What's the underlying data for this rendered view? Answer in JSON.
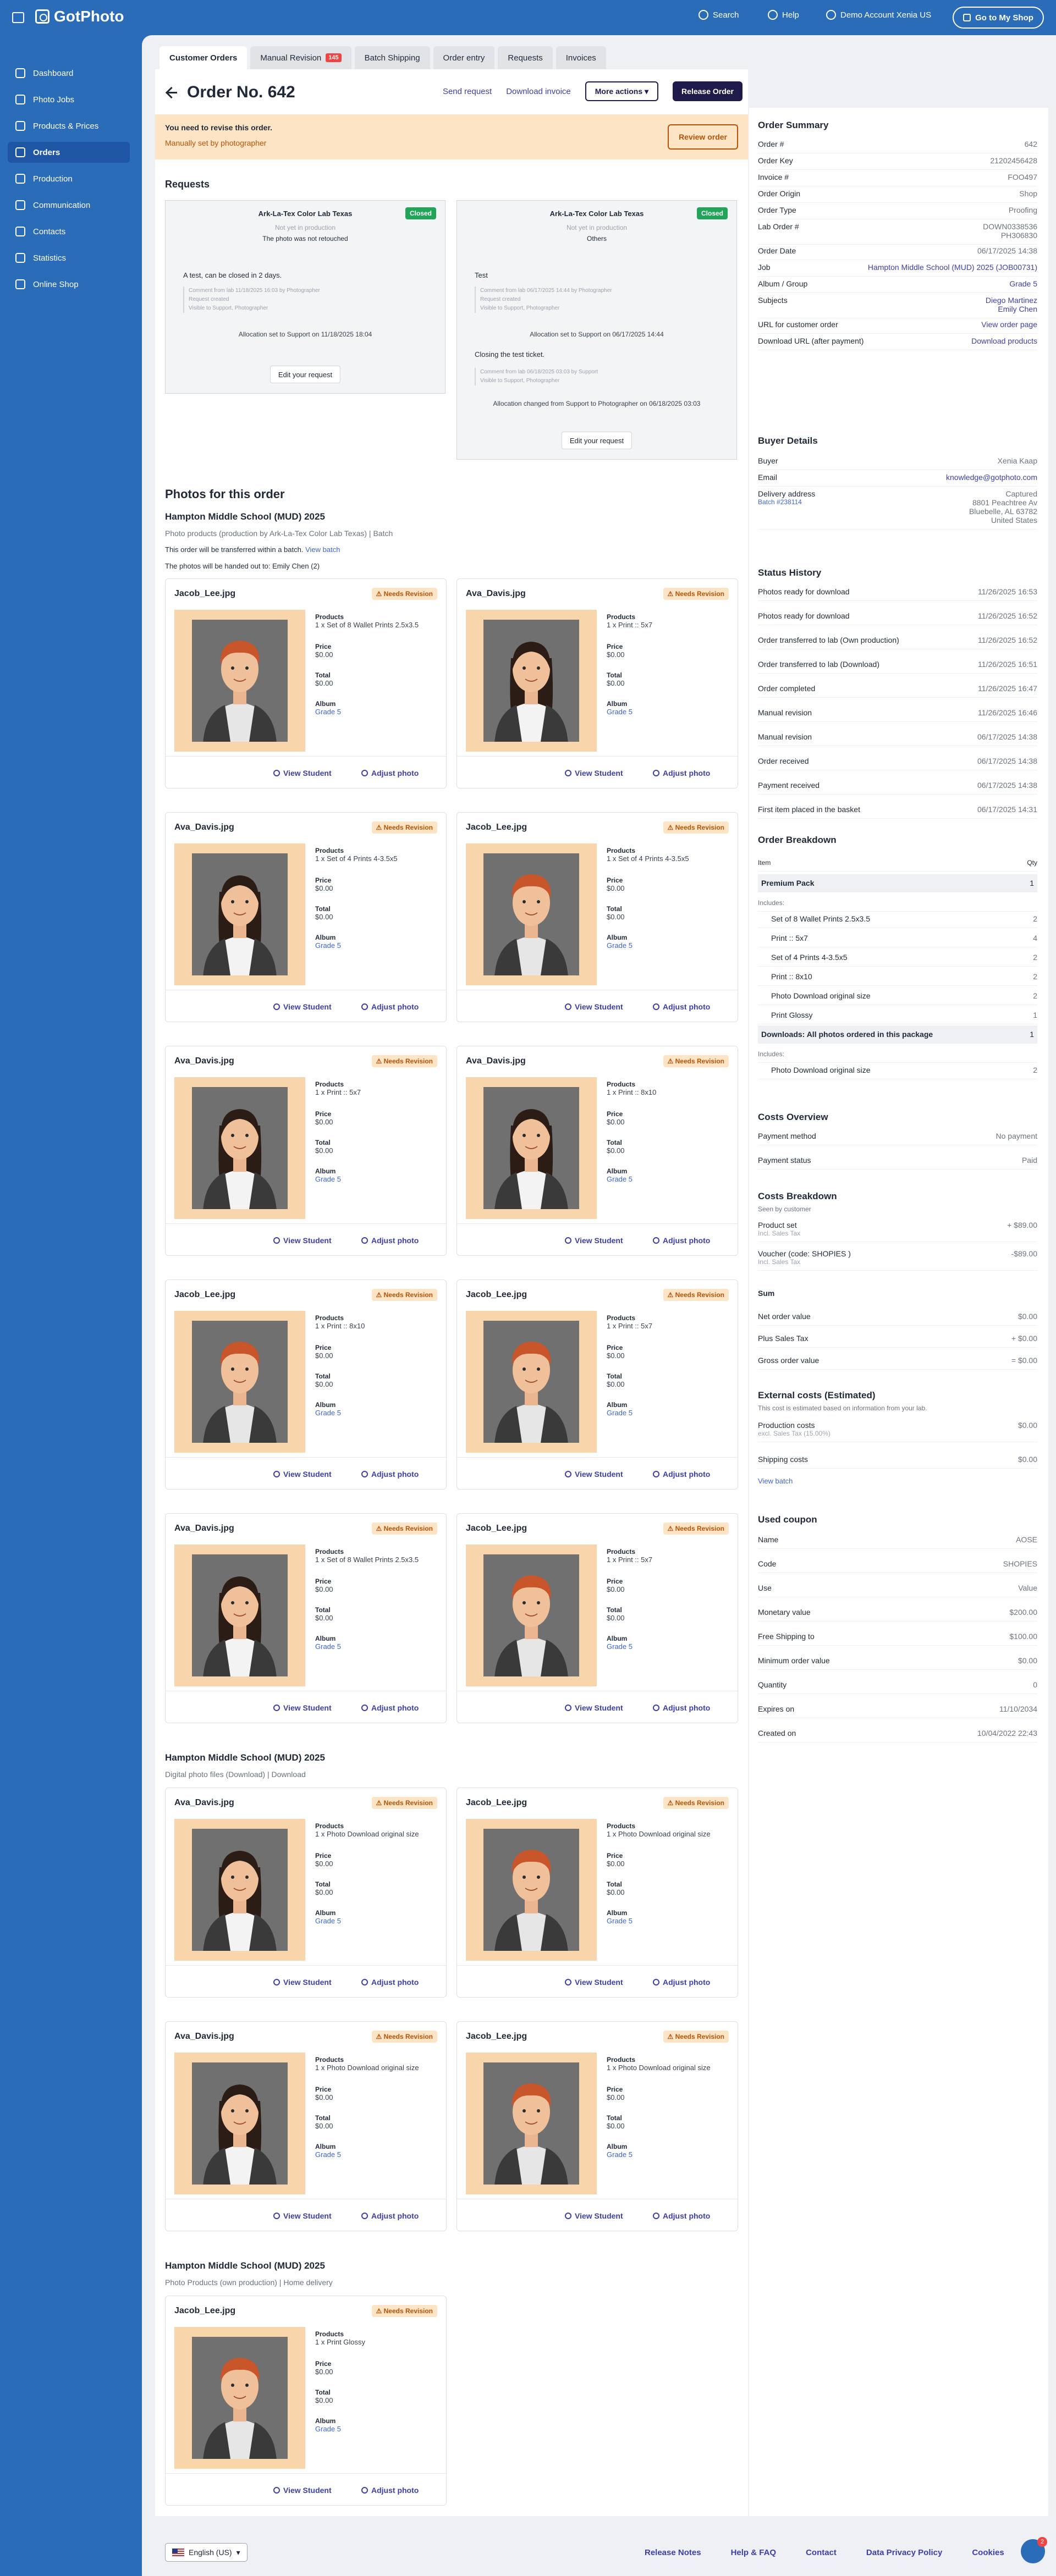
{
  "brand": {
    "name": "GotPhoto"
  },
  "topnav": {
    "search": "Search",
    "help": "Help",
    "account": "Demo Account Xenia US",
    "shop": "Go to My Shop"
  },
  "sidebar": {
    "items": [
      {
        "label": "Dashboard",
        "icon": "dashboard-icon"
      },
      {
        "label": "Photo Jobs",
        "icon": "camera-icon"
      },
      {
        "label": "Products & Prices",
        "icon": "tag-icon"
      },
      {
        "label": "Orders",
        "icon": "cart-icon"
      },
      {
        "label": "Production",
        "icon": "box-icon"
      },
      {
        "label": "Communication",
        "icon": "mail-icon"
      },
      {
        "label": "Contacts",
        "icon": "contacts-icon"
      },
      {
        "label": "Statistics",
        "icon": "chart-icon"
      },
      {
        "label": "Online Shop",
        "icon": "store-icon"
      }
    ]
  },
  "tabs": [
    {
      "label": "Customer Orders"
    },
    {
      "label": "Manual Revision",
      "badge": "145"
    },
    {
      "label": "Batch Shipping"
    },
    {
      "label": "Order entry"
    },
    {
      "label": "Requests"
    },
    {
      "label": "Invoices"
    }
  ],
  "order": {
    "title": "Order No. 642",
    "send_request": "Send request",
    "download_invoice": "Download invoice",
    "more_actions": "More actions",
    "release": "Release Order"
  },
  "alert": {
    "title": "You need to revise this order.",
    "sub": "Manually set by photographer",
    "button": "Review order"
  },
  "requests": {
    "title": "Requests",
    "items": [
      {
        "lab": "Ark-La-Tex Color Lab Texas",
        "status": "Closed",
        "line1": "Not yet in production",
        "line2": "The photo was not retouched",
        "msg": "A test, can be closed in 2 days.",
        "thread": [
          "Comment from lab 11/18/2025 16:03 by Photographer",
          "Request created",
          "Visible to Support, Photographer"
        ],
        "alloc": "Allocation set to Support on 11/18/2025 18:04",
        "edit": "Edit your request"
      },
      {
        "lab": "Ark-La-Tex Color Lab Texas",
        "status": "Closed",
        "line1": "Not yet in production",
        "line2": "Others",
        "msg": "Test",
        "thread": [
          "Comment from lab 06/17/2025 14:44 by Photographer",
          "Request created",
          "Visible to Support, Photographer"
        ],
        "alloc": "Allocation set to Support on 06/17/2025 14:44",
        "msg2": "Closing the test ticket.",
        "thread2": [
          "Comment from lab 06/18/2025 03:03 by Support",
          "Visible to Support, Photographer"
        ],
        "alloc2": "Allocation changed from Support to Photographer on 06/18/2025 03:03",
        "edit": "Edit your request"
      }
    ]
  },
  "photos": {
    "title": "Photos for this order",
    "labels": {
      "products": "Products",
      "price": "Price",
      "total": "Total",
      "album": "Album",
      "status": "Needs Revision",
      "view": "View Student",
      "adjust": "Adjust photo"
    },
    "groups": [
      {
        "title": "Hampton Middle School (MUD) 2025",
        "sub": "Photo products (production by Ark-La-Tex Color Lab Texas)",
        "sub2": "Batch",
        "note1": "This order will be transferred within a batch.",
        "note1_link": "View batch",
        "note2": "The photos will be handed out to: Emily Chen (2)",
        "cards": [
          {
            "file": "Jacob_Lee.jpg",
            "product": "1 x Set of 8 Wallet Prints 2.5x3.5",
            "price": "$0.00",
            "total": "$0.00",
            "album": "Grade 5",
            "who": "boy"
          },
          {
            "file": "Ava_Davis.jpg",
            "product": "1 x Print :: 5x7",
            "price": "$0.00",
            "total": "$0.00",
            "album": "Grade 5",
            "who": "girl"
          },
          {
            "file": "Ava_Davis.jpg",
            "product": "1 x Set of 4 Prints 4-3.5x5",
            "price": "$0.00",
            "total": "$0.00",
            "album": "Grade 5",
            "who": "girl"
          },
          {
            "file": "Jacob_Lee.jpg",
            "product": "1 x Set of 4 Prints 4-3.5x5",
            "price": "$0.00",
            "total": "$0.00",
            "album": "Grade 5",
            "who": "boy"
          },
          {
            "file": "Ava_Davis.jpg",
            "product": "1 x Print :: 5x7",
            "price": "$0.00",
            "total": "$0.00",
            "album": "Grade 5",
            "who": "girl"
          },
          {
            "file": "Ava_Davis.jpg",
            "product": "1 x Print :: 8x10",
            "price": "$0.00",
            "total": "$0.00",
            "album": "Grade 5",
            "who": "girl"
          },
          {
            "file": "Jacob_Lee.jpg",
            "product": "1 x Print :: 8x10",
            "price": "$0.00",
            "total": "$0.00",
            "album": "Grade 5",
            "who": "boy"
          },
          {
            "file": "Jacob_Lee.jpg",
            "product": "1 x Print :: 5x7",
            "price": "$0.00",
            "total": "$0.00",
            "album": "Grade 5",
            "who": "boy"
          },
          {
            "file": "Ava_Davis.jpg",
            "product": "1 x Set of 8 Wallet Prints 2.5x3.5",
            "price": "$0.00",
            "total": "$0.00",
            "album": "Grade 5",
            "who": "girl"
          },
          {
            "file": "Jacob_Lee.jpg",
            "product": "1 x Print :: 5x7",
            "price": "$0.00",
            "total": "$0.00",
            "album": "Grade 5",
            "who": "boy"
          }
        ]
      },
      {
        "title": "Hampton Middle School (MUD) 2025",
        "sub": "Digital photo files (Download)",
        "sub2": "Download",
        "cards": [
          {
            "file": "Ava_Davis.jpg",
            "product": "1 x Photo Download original size",
            "price": "$0.00",
            "total": "$0.00",
            "album": "Grade 5",
            "who": "girl"
          },
          {
            "file": "Jacob_Lee.jpg",
            "product": "1 x Photo Download original size",
            "price": "$0.00",
            "total": "$0.00",
            "album": "Grade 5",
            "who": "boy"
          },
          {
            "file": "Ava_Davis.jpg",
            "product": "1 x Photo Download original size",
            "price": "$0.00",
            "total": "$0.00",
            "album": "Grade 5",
            "who": "girl"
          },
          {
            "file": "Jacob_Lee.jpg",
            "product": "1 x Photo Download original size",
            "price": "$0.00",
            "total": "$0.00",
            "album": "Grade 5",
            "who": "boy"
          }
        ]
      },
      {
        "title": "Hampton Middle School (MUD) 2025",
        "sub": "Photo Products (own production)",
        "sub2": "Home delivery",
        "cards": [
          {
            "file": "Jacob_Lee.jpg",
            "product": "1 x Print Glossy",
            "price": "$0.00",
            "total": "$0.00",
            "album": "Grade 5",
            "who": "boy"
          }
        ]
      }
    ]
  },
  "summary": {
    "title": "Order Summary",
    "rows": [
      {
        "k": "Order #",
        "v": "642"
      },
      {
        "k": "Order Key",
        "v": "21202456428"
      },
      {
        "k": "Invoice #",
        "v": "FOO497"
      },
      {
        "k": "Order Origin",
        "v": "Shop"
      },
      {
        "k": "Order Type",
        "v": "Proofing"
      },
      {
        "k": "Lab Order #",
        "v": "DOWN0338536\nPH306830"
      },
      {
        "k": "Order Date",
        "v": "06/17/2025 14:38"
      },
      {
        "k": "Job",
        "v": "Hampton Middle School (MUD) 2025 (JOB00731)",
        "link": true
      },
      {
        "k": "Album / Group",
        "v": "Grade 5",
        "link": true
      },
      {
        "k": "Subjects",
        "v": "Diego Martinez\nEmily Chen",
        "link": true
      },
      {
        "k": "URL for customer order",
        "v": "View order page",
        "link": true
      },
      {
        "k": "Download URL (after payment)",
        "v": "Download products",
        "link": true
      }
    ],
    "buyer_title": "Buyer Details",
    "buyer": [
      {
        "k": "Buyer",
        "v": "Xenia Kaap"
      },
      {
        "k": "Email",
        "v": "knowledge@gotphoto.com",
        "link": true
      },
      {
        "k": "Delivery address",
        "v": "Captured\n8801 Peachtree Av\nBluebelle, AL 63782\nUnited States",
        "sub": "Batch #238114"
      }
    ],
    "status_title": "Status History",
    "status": [
      {
        "k": "Photos ready for download",
        "v": "11/26/2025 16:53"
      },
      {
        "k": "Photos ready for download",
        "v": "11/26/2025 16:52"
      },
      {
        "k": "Order transferred to lab (Own production)",
        "v": "11/26/2025 16:52"
      },
      {
        "k": "Order transferred to lab (Download)",
        "v": "11/26/2025 16:51"
      },
      {
        "k": "Order completed",
        "v": "11/26/2025 16:47"
      },
      {
        "k": "Manual revision",
        "v": "11/26/2025 16:46"
      },
      {
        "k": "Manual revision",
        "v": "06/17/2025 14:38"
      },
      {
        "k": "Order received",
        "v": "06/17/2025 14:38"
      },
      {
        "k": "Payment received",
        "v": "06/17/2025 14:38"
      },
      {
        "k": "First item placed in the basket",
        "v": "06/17/2025 14:31"
      }
    ],
    "breakdown_title": "Order Breakdown",
    "breakdown_head": {
      "item": "Item",
      "qty": "Qty"
    },
    "breakdown": [
      {
        "k": "Premium Pack",
        "v": "1",
        "bold": true,
        "shade": true
      },
      {
        "k": "Includes:",
        "v": "",
        "small": true
      },
      {
        "k": "Set of 8 Wallet Prints 2.5x3.5",
        "v": "2",
        "indent": true
      },
      {
        "k": "Print :: 5x7",
        "v": "4",
        "indent": true
      },
      {
        "k": "Set of 4 Prints 4-3.5x5",
        "v": "2",
        "indent": true
      },
      {
        "k": "Print :: 8x10",
        "v": "2",
        "indent": true
      },
      {
        "k": "Photo Download original size",
        "v": "2",
        "indent": true
      },
      {
        "k": "Print Glossy",
        "v": "1",
        "indent": true
      },
      {
        "k": "Downloads: All photos ordered in this package",
        "v": "1",
        "bold": true,
        "shade": true
      },
      {
        "k": "Includes:",
        "v": "",
        "small": true
      },
      {
        "k": "Photo Download original size",
        "v": "2",
        "indent": true
      }
    ],
    "costs_title": "Costs Overview",
    "costs": [
      {
        "k": "Payment method",
        "v": "No payment"
      },
      {
        "k": "Payment status",
        "v": "Paid"
      }
    ],
    "cb_title": "Costs Breakdown",
    "cb_sub": "Seen by customer",
    "cb": [
      {
        "k": "Product set",
        "sub": "Incl. Sales Tax",
        "v": "+ $89.00"
      },
      {
        "k": "Voucher (code: SHOPIES )",
        "sub": "Incl. Sales Tax",
        "v": "-$89.00"
      }
    ],
    "sum_label": "Sum",
    "sum": [
      {
        "k": "Net order value",
        "v": "$0.00"
      },
      {
        "k": "Plus Sales Tax",
        "v": "+ $0.00"
      },
      {
        "k": "Gross order value",
        "v": "= $0.00"
      }
    ],
    "ext_title": "External costs (Estimated)",
    "ext_sub": "This cost is estimated based on information from your lab.",
    "ext": [
      {
        "k": "Production costs",
        "sub": "excl. Sales Tax (15.00%)",
        "v": "$0.00"
      },
      {
        "k": "Shipping costs",
        "sub": "",
        "v": "$0.00"
      }
    ],
    "ext_link": "View batch",
    "coupon_title": "Used coupon",
    "coupon": [
      {
        "k": "Name",
        "v": "AOSE"
      },
      {
        "k": "Code",
        "v": "SHOPIES"
      },
      {
        "k": "Use",
        "v": "Value"
      },
      {
        "k": "Monetary value",
        "v": "$200.00"
      },
      {
        "k": "Free Shipping to",
        "v": "$100.00"
      },
      {
        "k": "Minimum order value",
        "v": "$0.00"
      },
      {
        "k": "Quantity",
        "v": "0"
      },
      {
        "k": "Expires on",
        "v": "11/10/2034"
      },
      {
        "k": "Created on",
        "v": "10/04/2022 22:43"
      }
    ]
  },
  "footer": {
    "lang": "English (US)",
    "links": [
      "Release Notes",
      "Help & FAQ",
      "Contact",
      "Data Privacy Policy",
      "Cookies"
    ],
    "chat_badge": "2"
  }
}
